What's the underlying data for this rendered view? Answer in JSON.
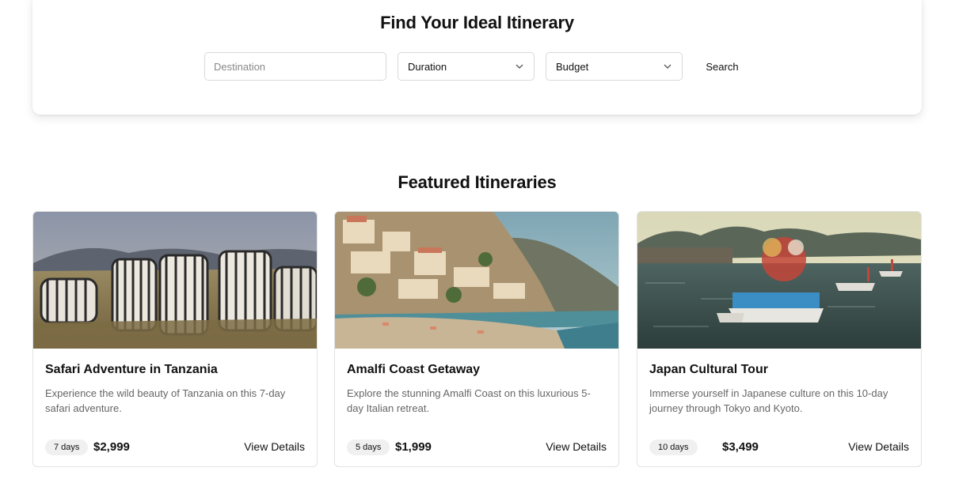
{
  "search": {
    "title": "Find Your Ideal Itinerary",
    "destination_placeholder": "Destination",
    "destination_value": "",
    "duration_label": "Duration",
    "budget_label": "Budget",
    "search_label": "Search"
  },
  "featured": {
    "title": "Featured Itineraries",
    "cards": [
      {
        "title": "Safari Adventure in Tanzania",
        "description": "Experience the wild beauty of Tanzania on this 7-day safari adventure.",
        "days": "7 days",
        "price": "$2,999",
        "action": "View Details",
        "image": "zebras-savanna-photo"
      },
      {
        "title": "Amalfi Coast Getaway",
        "description": "Explore the stunning Amalfi Coast on this luxurious 5-day Italian retreat.",
        "days": "5 days",
        "price": "$1,999",
        "action": "View Details",
        "image": "amalfi-coast-beach-photo"
      },
      {
        "title": "Japan Cultural Tour",
        "description": "Immerse yourself in Japanese culture on this 10-day journey through Tokyo and Kyoto.",
        "days": "10 days",
        "price": "$3,499",
        "action": "View Details",
        "image": "japanese-boat-festival-photo"
      }
    ]
  }
}
